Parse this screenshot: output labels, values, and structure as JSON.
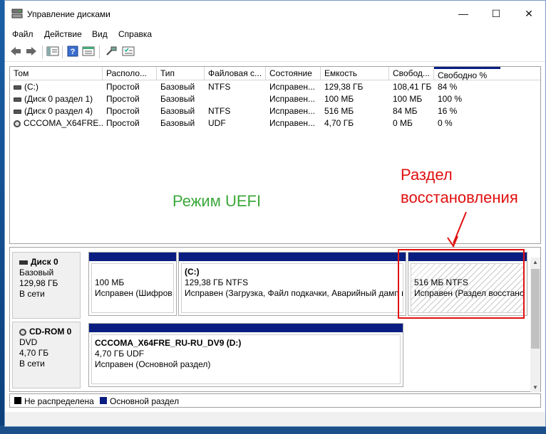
{
  "window": {
    "title": "Управление дисками",
    "minimize": "—",
    "maximize": "☐",
    "close": "✕"
  },
  "menu": {
    "file": "Файл",
    "action": "Действие",
    "view": "Вид",
    "help": "Справка"
  },
  "volumes": {
    "columns": [
      "Том",
      "Располо...",
      "Тип",
      "Файловая с...",
      "Состояние",
      "Емкость",
      "Свобод...",
      "Свободно %"
    ],
    "rows": [
      {
        "name": "(C:)",
        "layout": "Простой",
        "type": "Базовый",
        "fs": "NTFS",
        "status": "Исправен...",
        "capacity": "129,38 ГБ",
        "free": "108,41 ГБ",
        "free_pct": "84 %",
        "icon": "drive-icon"
      },
      {
        "name": "(Диск 0 раздел 1)",
        "layout": "Простой",
        "type": "Базовый",
        "fs": "",
        "status": "Исправен...",
        "capacity": "100 МБ",
        "free": "100 МБ",
        "free_pct": "100 %",
        "icon": "drive-icon"
      },
      {
        "name": "(Диск 0 раздел 4)",
        "layout": "Простой",
        "type": "Базовый",
        "fs": "NTFS",
        "status": "Исправен...",
        "capacity": "516 МБ",
        "free": "84 МБ",
        "free_pct": "16 %",
        "icon": "drive-icon"
      },
      {
        "name": "CCCOMA_X64FRE...",
        "layout": "Простой",
        "type": "Базовый",
        "fs": "UDF",
        "status": "Исправен...",
        "capacity": "4,70 ГБ",
        "free": "0 МБ",
        "free_pct": "0 %",
        "icon": "cd-icon"
      }
    ]
  },
  "annotations": {
    "uefi": "Режим UEFI",
    "recovery_line1": "Раздел",
    "recovery_line2": "восстановления"
  },
  "disks": {
    "disk0": {
      "name": "Диск 0",
      "type": "Базовый",
      "size": "129,98 ГБ",
      "state": "В сети",
      "partitions": [
        {
          "title": "",
          "size": "100 МБ",
          "status": "Исправен (Шифров"
        },
        {
          "title": "(C:)",
          "size": "129,38 ГБ NTFS",
          "status": "Исправен (Загрузка, Файл подкачки, Аварийный дамп п"
        },
        {
          "title": "",
          "size": "516 МБ NTFS",
          "status": "Исправен (Раздел восстанов"
        }
      ]
    },
    "cdrom0": {
      "name": "CD-ROM 0",
      "type": "DVD",
      "size": "4,70 ГБ",
      "state": "В сети",
      "partition": {
        "title": "CCCOMA_X64FRE_RU-RU_DV9  (D:)",
        "size": "4,70 ГБ UDF",
        "status": "Исправен (Основной раздел)"
      }
    }
  },
  "legend": {
    "unallocated": "Не распределена",
    "primary": "Основной раздел",
    "unallocated_color": "#000000",
    "primary_color": "#0a1e82"
  },
  "colors": {
    "annotation": "#e01010",
    "uefi_text": "#3ca83c",
    "partition_bar": "#0a1e82"
  }
}
